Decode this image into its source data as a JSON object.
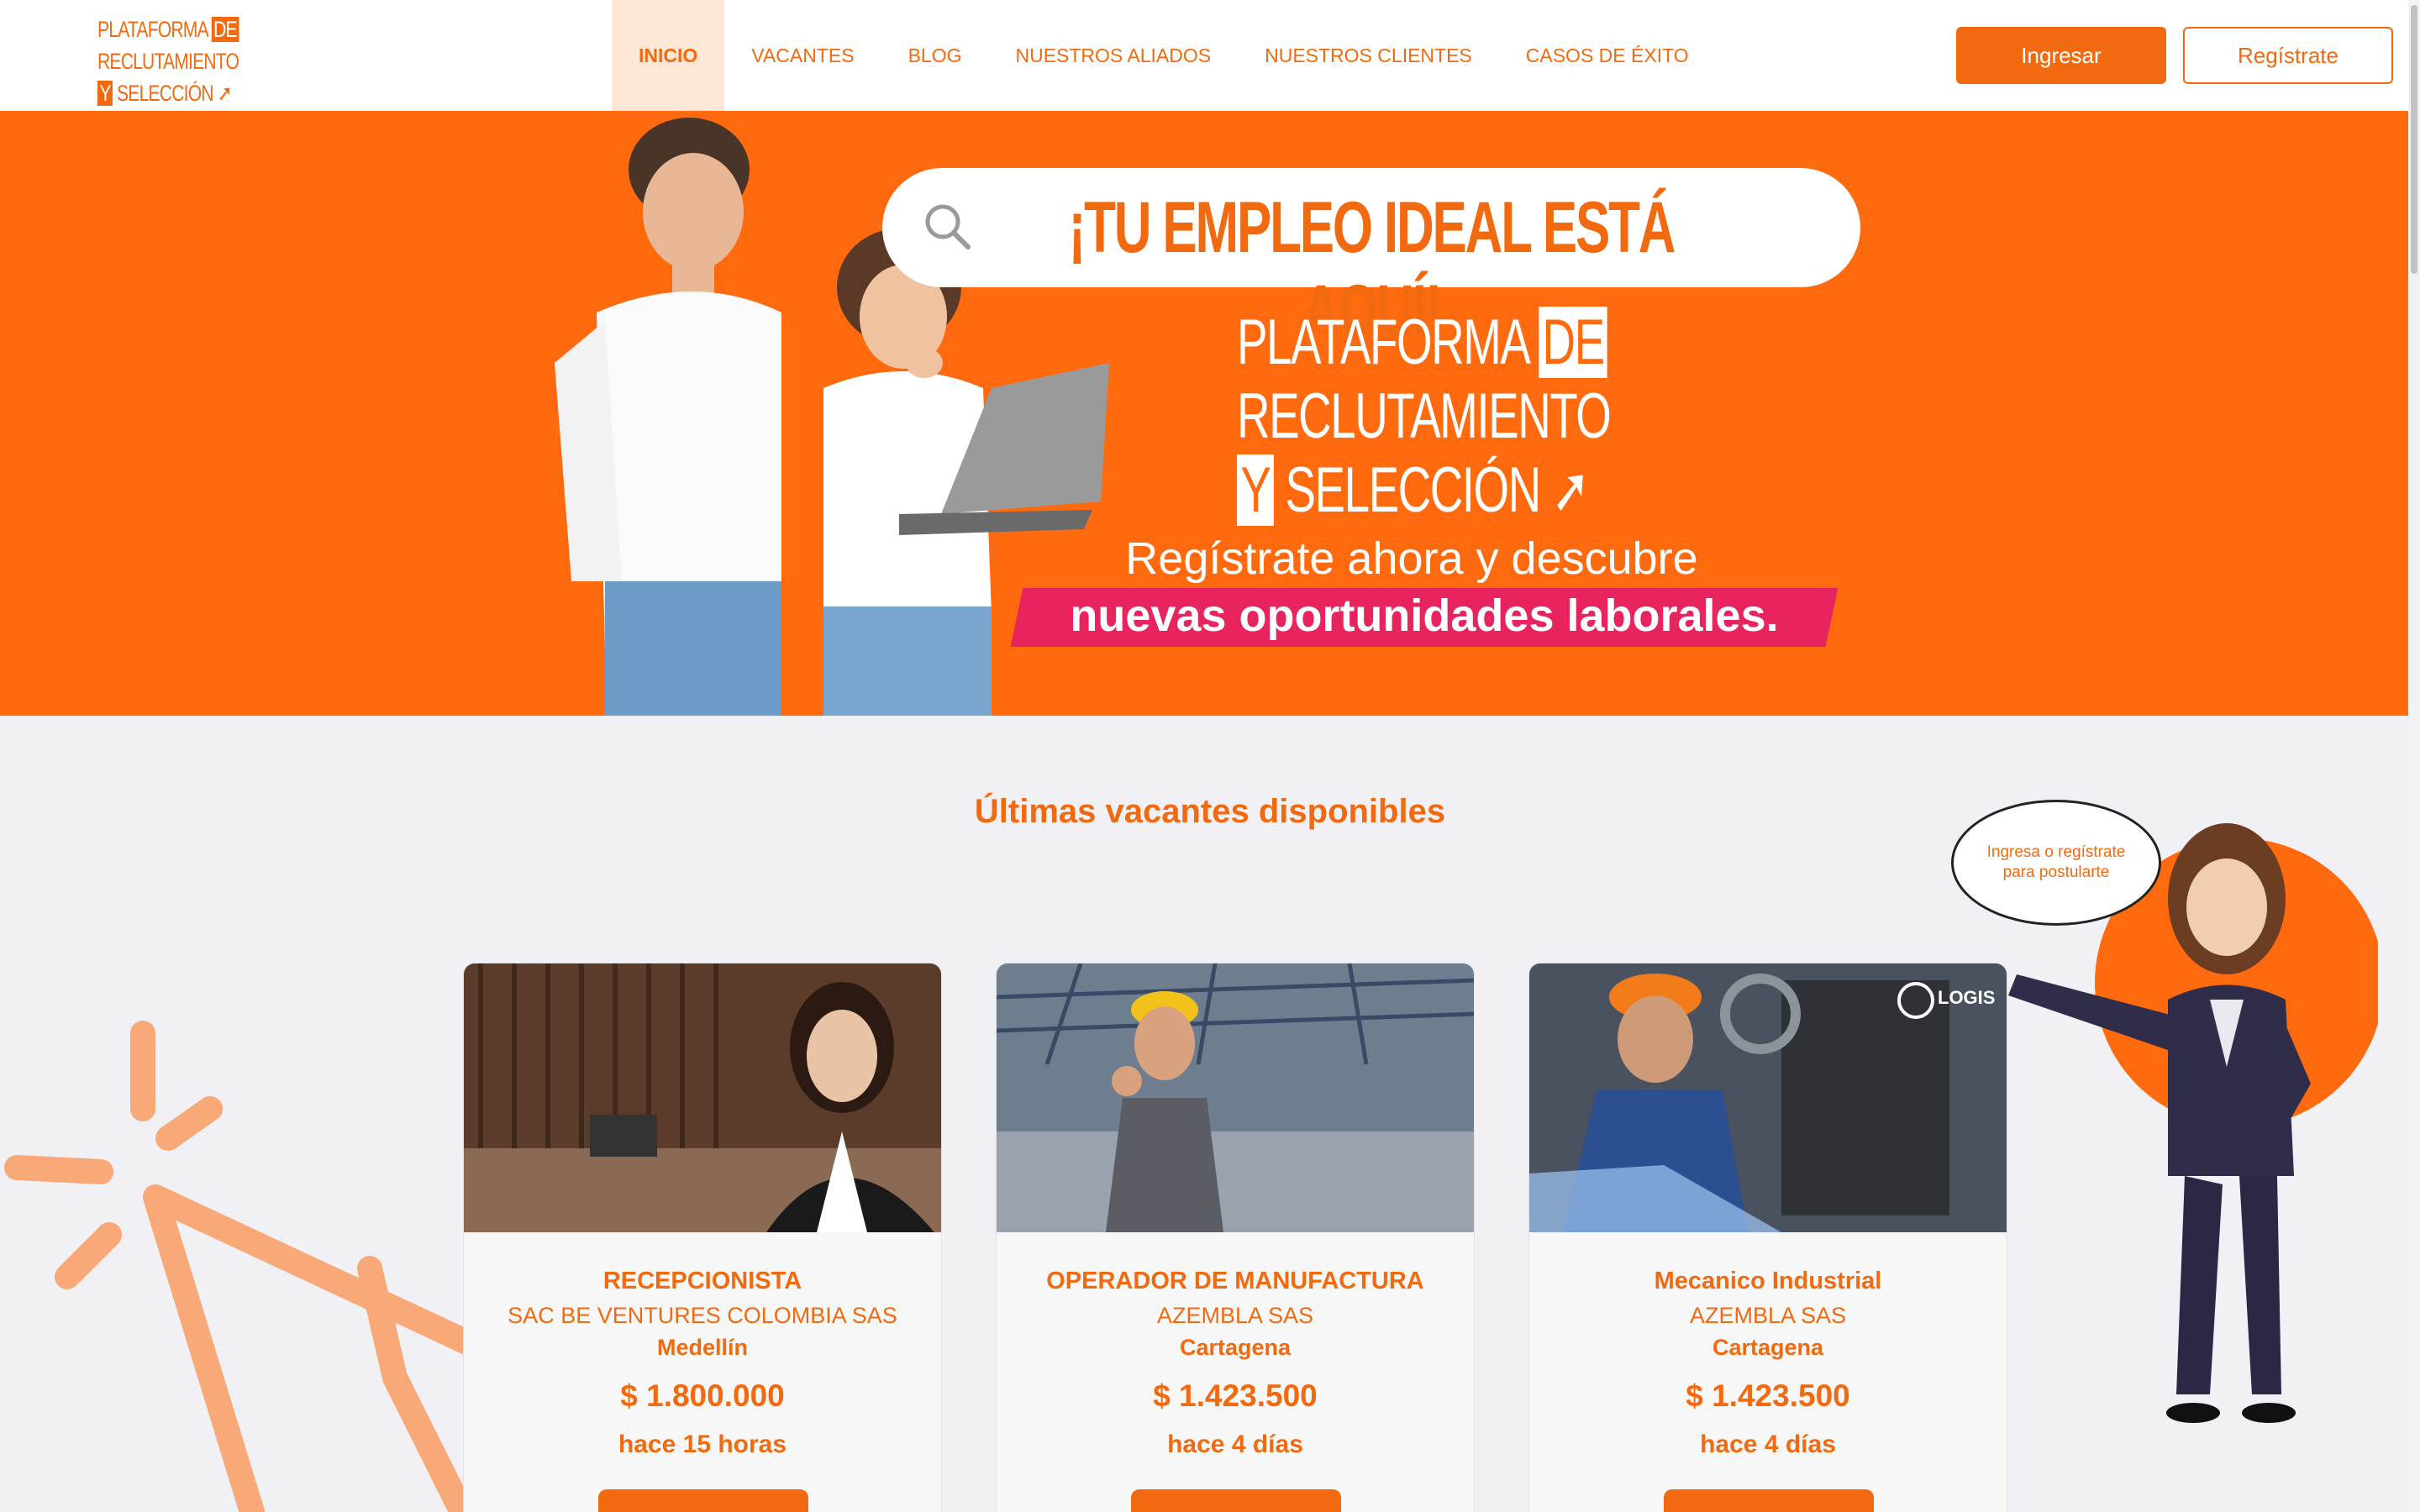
{
  "navbar": {
    "logo": {
      "line1": "PLATAFORMA",
      "line1_box": "DE",
      "line2": "RECLUTAMIENTO",
      "line3_box": "Y",
      "line3": "SELECCIÓN"
    },
    "items": [
      {
        "label": "INICIO",
        "active": true
      },
      {
        "label": "VACANTES",
        "active": false
      },
      {
        "label": "BLOG",
        "active": false
      },
      {
        "label": "NUESTROS ALIADOS",
        "active": false
      },
      {
        "label": "NUESTROS CLIENTES",
        "active": false
      },
      {
        "label": "CASOS DE ÉXITO",
        "active": false
      }
    ],
    "login_label": "Ingresar",
    "register_label": "Regístrate"
  },
  "hero": {
    "headline": "¡TU EMPLEO IDEAL ESTÁ AQUÍ!",
    "brand": {
      "line1": "PLATAFORMA",
      "line1_box": "DE",
      "line2": "RECLUTAMIENTO",
      "line3_box": "Y",
      "line3": "SELECCIÓN"
    },
    "tagline": "Regístrate ahora y descubre",
    "tagline_highlight": "nuevas oportunidades laborales."
  },
  "jobs": {
    "section_title": "Últimas vacantes disponibles",
    "cards": [
      {
        "title": "RECEPCIONISTA",
        "company": "SAC BE VENTURES COLOMBIA SAS",
        "city": "Medellín",
        "salary": "$ 1.800.000",
        "posted": "hace 15 horas"
      },
      {
        "title": "OPERADOR DE MANUFACTURA",
        "company": "AZEMBLA SAS",
        "city": "Cartagena",
        "salary": "$ 1.423.500",
        "posted": "hace 4 días"
      },
      {
        "title": "Mecanico Industrial",
        "company": "AZEMBLA SAS",
        "city": "Cartagena",
        "salary": "$ 1.423.500",
        "posted": "hace 4 días"
      }
    ],
    "card3_brand": "LOGIS"
  },
  "mascot": {
    "bubble_text": "Ingresa o regístrate para postularte"
  },
  "colors": {
    "accent": "#f26a10",
    "hero_bg": "#ff6a0f",
    "highlight": "#e8245f",
    "page_bg": "#f0f0f5"
  }
}
